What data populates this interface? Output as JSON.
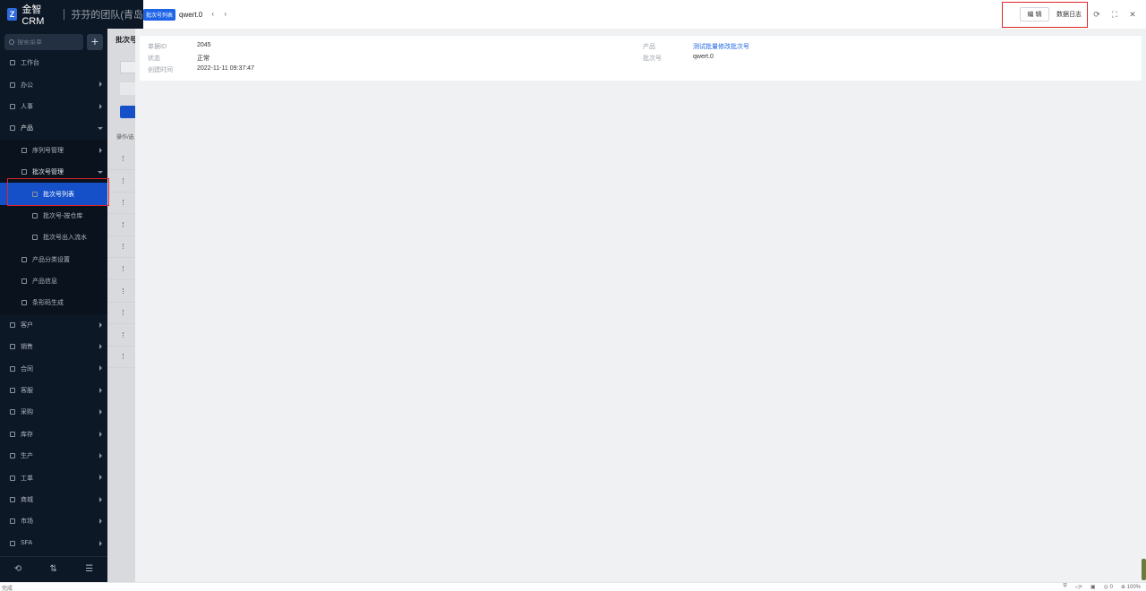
{
  "brand": {
    "name": "金智CRM",
    "team": "芬芬的团队(青岛"
  },
  "sidebar": {
    "search_placeholder": "搜索菜单",
    "add_label": "+",
    "items": [
      {
        "label": "工作台",
        "level": 1,
        "arrow": false
      },
      {
        "label": "办公",
        "level": 1,
        "arrow": true
      },
      {
        "label": "人事",
        "level": 1,
        "arrow": true
      },
      {
        "label": "产品",
        "level": 1,
        "arrow": "down",
        "open": true
      },
      {
        "label": "序列号管理",
        "level": 2,
        "arrow": true
      },
      {
        "label": "批次号管理",
        "level": 2,
        "arrow": "down",
        "open": true
      },
      {
        "label": "批次号列表",
        "level": 3,
        "active": true
      },
      {
        "label": "批次号-按仓库",
        "level": 3
      },
      {
        "label": "批次号出入流水",
        "level": 3
      },
      {
        "label": "产品分类设置",
        "level": 2
      },
      {
        "label": "产品信息",
        "level": 2
      },
      {
        "label": "条形码生成",
        "level": 2
      },
      {
        "label": "客户",
        "level": 1,
        "arrow": true
      },
      {
        "label": "销售",
        "level": 1,
        "arrow": true
      },
      {
        "label": "合同",
        "level": 1,
        "arrow": true
      },
      {
        "label": "客服",
        "level": 1,
        "arrow": true
      },
      {
        "label": "采购",
        "level": 1,
        "arrow": true
      },
      {
        "label": "库存",
        "level": 1,
        "arrow": true
      },
      {
        "label": "生产",
        "level": 1,
        "arrow": true
      },
      {
        "label": "工单",
        "level": 1,
        "arrow": true
      },
      {
        "label": "商城",
        "level": 1,
        "arrow": true
      },
      {
        "label": "市场",
        "level": 1,
        "arrow": true
      },
      {
        "label": "SFA",
        "level": 1,
        "arrow": true
      }
    ],
    "footer": [
      "⟲",
      "⇅",
      "☰"
    ]
  },
  "background_page": {
    "title": "批次号",
    "ops": "操作/选"
  },
  "drawer": {
    "tag": "批次号列表",
    "title": "qwert.0",
    "prev": "‹",
    "next": "›",
    "edit_label": "编 辑",
    "log_label": "数据日志",
    "icons": [
      "refresh-icon",
      "fullscreen-icon",
      "close-icon"
    ],
    "fields_left": [
      {
        "label": "单据ID",
        "value": "2045"
      },
      {
        "label": "状态",
        "value": "正常"
      },
      {
        "label": "创建时间",
        "value": "2022-11-11 09:37:47"
      }
    ],
    "fields_right": [
      {
        "label": "产品",
        "value": "测试批量修改批次号",
        "link": true
      },
      {
        "label": "批次号",
        "value": "qwert.0"
      }
    ]
  },
  "statusbar": {
    "left": "完成",
    "zoom": "100%",
    "count": "0"
  },
  "colors": {
    "accent": "#1e64e6",
    "sidebar_bg": "#0d1826",
    "highlight": "#e0262b"
  }
}
